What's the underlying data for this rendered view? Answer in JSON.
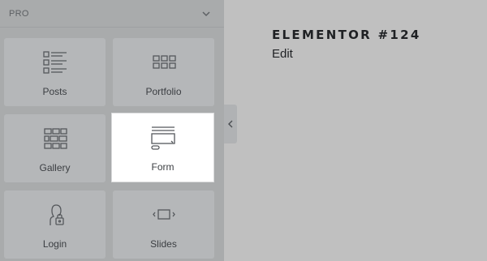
{
  "panel": {
    "section_title": "PRO",
    "collapse_icon": "chevron-down-icon",
    "widgets": [
      {
        "label": "Posts",
        "icon": "posts-list-icon",
        "active": false
      },
      {
        "label": "Portfolio",
        "icon": "portfolio-grid-icon",
        "active": false
      },
      {
        "label": "Gallery",
        "icon": "gallery-grid-icon",
        "active": false
      },
      {
        "label": "Form",
        "icon": "form-icon",
        "active": true
      },
      {
        "label": "Login",
        "icon": "login-user-icon",
        "active": false
      },
      {
        "label": "Slides",
        "icon": "slides-icon",
        "active": false
      }
    ],
    "toggle_icon": "chevron-left-icon"
  },
  "preview": {
    "title": "ELEMENTOR #124",
    "link": "Edit"
  },
  "colors": {
    "sidebar_bg": "#a9abac",
    "tile_bg": "#b5b7b9",
    "tile_active_bg": "#ffffff",
    "canvas_bg": "#c0c0c0",
    "text": "#3b3e42"
  }
}
